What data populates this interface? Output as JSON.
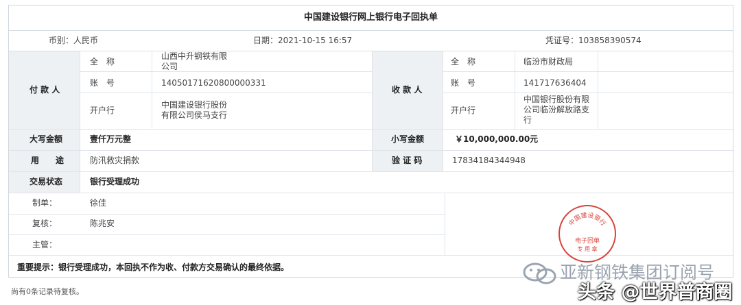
{
  "receipt": {
    "title": "中国建设银行网上银行电子回执单",
    "currency": "币别：人民币",
    "date": "日期：2021-10-15 16:57",
    "voucher": "凭证号：103858390574"
  },
  "payer": {
    "heading": "付 款 人",
    "name_label": "全　称",
    "name_value": [
      "山西中升钢铁有限",
      "公司"
    ],
    "account_label": "账　号",
    "account_value": "14050171620800000331",
    "bank_label": "开户行",
    "bank_value": [
      "中国建设银行股份",
      "有限公司侯马支行"
    ]
  },
  "payee": {
    "heading": "收 款 人",
    "name_label": "全　称",
    "name_value": "临汾市财政局",
    "account_label": "账　号",
    "account_value": "141717636404",
    "bank_label": "开户行",
    "bank_value": [
      "中国银行股份有限",
      "公司临汾解放路支",
      "行"
    ]
  },
  "amount": {
    "upper_label": "大写金额",
    "upper_value": "壹仟万元整",
    "lower_label": "小写金额",
    "lower_value": "￥10,000,000.00元"
  },
  "purpose": {
    "label": "用　　途",
    "value": "防汛救灾捐款",
    "code_label": "验 证 码",
    "code_value": "17834184344948"
  },
  "status": {
    "label": "交易状态",
    "value": "银行受理成功"
  },
  "staff": {
    "maker_label": "制单：",
    "maker_value": "徐佳",
    "checker_label": "复核：",
    "checker_value": "陈兆安",
    "supervisor_label": "主管："
  },
  "notice": "重要提示：银行受理成功，本回执不作为收、付款方交易确认的最终依据。",
  "footnote": "尚有0条记录待复核。",
  "stamp": {
    "line1": "中国建设银行",
    "line2": "电子回单",
    "line3": "专 用 章"
  },
  "watermarks": {
    "account": "亚新钢铁集团订阅号",
    "toutiao": "头条 @世界普商圈"
  },
  "colors": {
    "stamp_red": "#d9433b",
    "cell_grey": "#eef1f4",
    "border": "#cfd6df"
  }
}
